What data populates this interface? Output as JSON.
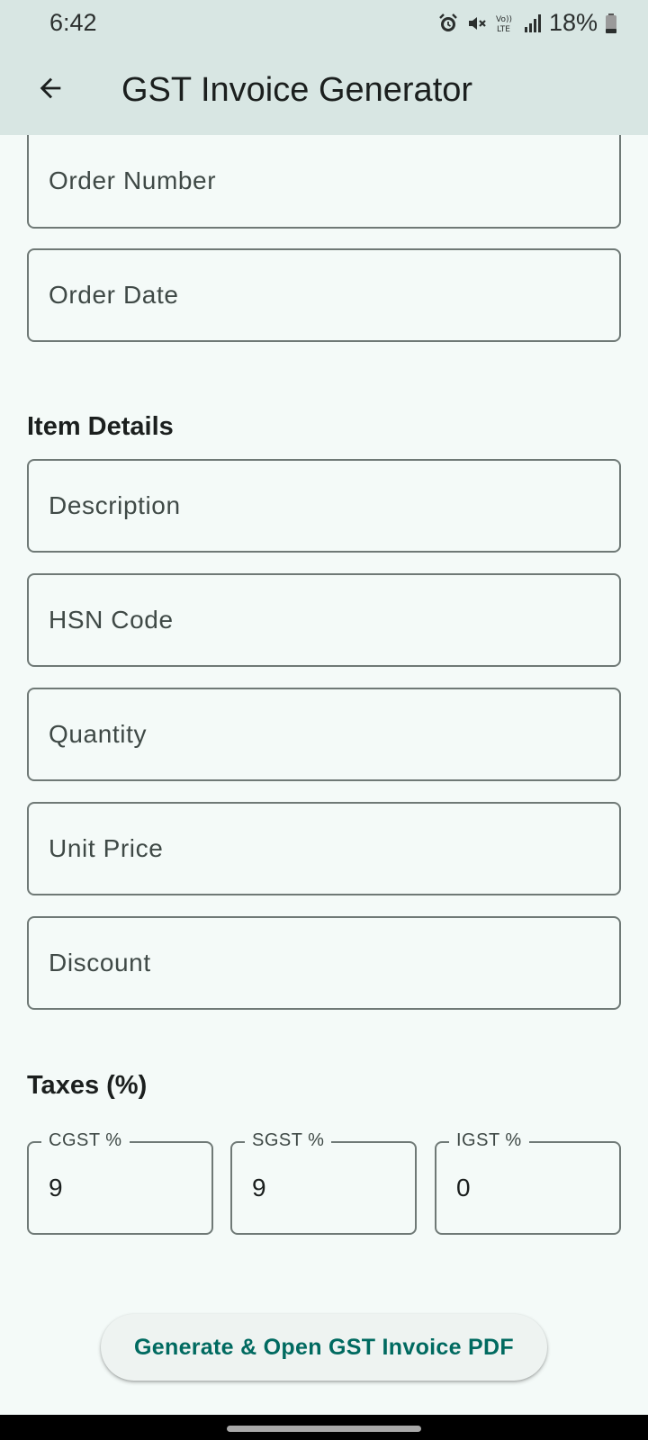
{
  "status_bar": {
    "time": "6:42",
    "battery": "18%",
    "icons": [
      "alarm-icon",
      "mute-icon",
      "volte-icon",
      "signal-icon",
      "battery-icon"
    ]
  },
  "app_bar": {
    "title": "GST Invoice Generator",
    "back_icon": "arrow-back-icon"
  },
  "order": {
    "order_number_placeholder": "Order Number",
    "order_date_placeholder": "Order Date"
  },
  "item_details": {
    "title": "Item Details",
    "description_placeholder": "Description",
    "hsn_placeholder": "HSN Code",
    "quantity_placeholder": "Quantity",
    "unit_price_placeholder": "Unit Price",
    "discount_placeholder": "Discount"
  },
  "taxes": {
    "title": "Taxes (%)",
    "cgst": {
      "label": "CGST %",
      "value": "9"
    },
    "sgst": {
      "label": "SGST %",
      "value": "9"
    },
    "igst": {
      "label": "IGST %",
      "value": "0"
    }
  },
  "actions": {
    "generate_label": "Generate & Open GST Invoice PDF"
  },
  "colors": {
    "app_bar": "#d8e6e3",
    "background": "#f4faf8",
    "accent": "#006a60",
    "outline": "#6f7976"
  }
}
